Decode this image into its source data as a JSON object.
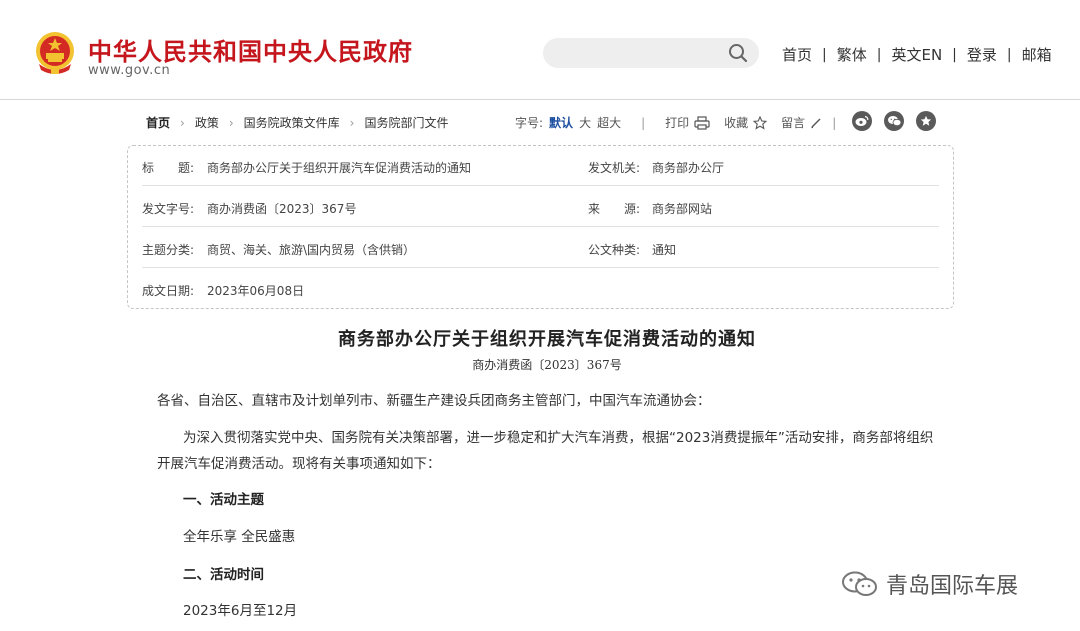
{
  "header": {
    "site_title": "中华人民共和国中央人民政府",
    "site_domain": "www.gov.cn",
    "search": {
      "value": "",
      "placeholder": ""
    },
    "nav": [
      "首页",
      "繁体",
      "英文EN",
      "登录",
      "邮箱"
    ],
    "nav_separator": "|"
  },
  "breadcrumb": {
    "items": [
      "首页",
      "政策",
      "国务院政策文件库",
      "国务院部门文件"
    ],
    "arrow": "›"
  },
  "toolbar": {
    "font_label": "字号:",
    "font_sizes": [
      "默认",
      "大",
      "超大"
    ],
    "active_font": "默认",
    "separator": "|",
    "print": "打印",
    "favorite": "收藏",
    "comment": "留言"
  },
  "share_icons": [
    "weibo-icon",
    "wechat-icon",
    "star-icon"
  ],
  "meta": {
    "title_label": "标　　题:",
    "title_value": "商务部办公厅关于组织开展汽车促消费活动的通知",
    "issuer_label": "发文机关:",
    "issuer_value": "商务部办公厅",
    "docno_label": "发文字号:",
    "docno_value": "商办消费函〔2023〕367号",
    "source_label": "来　　源:",
    "source_value": "商务部网站",
    "topic_label": "主题分类:",
    "topic_value": "商贸、海关、旅游\\国内贸易（含供销）",
    "type_label": "公文种类:",
    "type_value": "通知",
    "date_label": "成文日期:",
    "date_value": "2023年06月08日"
  },
  "article": {
    "title": "商务部办公厅关于组织开展汽车促消费活动的通知",
    "docno": "商办消费函〔2023〕367号",
    "salutation": "各省、自治区、直辖市及计划单列市、新疆生产建设兵团商务主管部门，中国汽车流通协会：",
    "intro_line1": "为深入贯彻落实党中央、国务院有关决策部署，进一步稳定和扩大汽车消费，根据“2023消费提振年”活动安排，商务部将组织",
    "intro_line2": "开展汽车促消费活动。现将有关事项通知如下：",
    "h1": "一、活动主题",
    "theme": "全年乐享  全民盛惠",
    "h2": "二、活动时间",
    "time": "2023年6月至12月"
  },
  "watermark": "青岛国际车展",
  "colors": {
    "brand_red": "#c4161c",
    "active_blue": "#1d4fa0",
    "gold": "#f2c230"
  }
}
